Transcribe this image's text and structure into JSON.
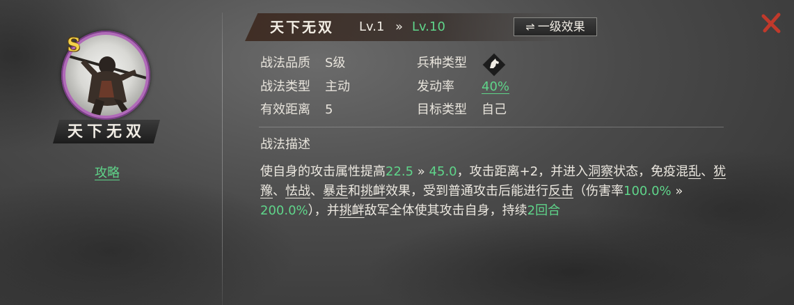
{
  "skill": {
    "name": "天下无双",
    "grade_letter": "S",
    "level_current": "Lv.1",
    "level_arrow": "»",
    "level_max": "Lv.10",
    "effect_button": "一级效果",
    "effect_button_icon": "swap-icon"
  },
  "left_panel": {
    "portrait_name": "天下无双",
    "strategy_link": "攻略"
  },
  "attributes": {
    "quality_label": "战法品质",
    "quality_value": "S级",
    "type_label": "战法类型",
    "type_value": "主动",
    "range_label": "有效距离",
    "range_value": "5",
    "troop_label": "兵种类型",
    "troop_icon": "cavalry-horse-icon",
    "rate_label": "发动率",
    "rate_value": "40%",
    "target_label": "目标类型",
    "target_value": "自己"
  },
  "description": {
    "title": "战法描述",
    "p1": "使自身的攻击属性提高",
    "v1": "22.5",
    "arrow1": " » ",
    "v2": "45.0",
    "p2": "，攻击距离+2，并进入",
    "k1": "洞察",
    "p3": "状态，免疫混",
    "k2": "乱",
    "p4": "、",
    "k3": "犹豫",
    "p5": "、",
    "k4": "怯战",
    "p6": "、",
    "k5": "暴走",
    "p7": "和",
    "k6": "挑衅",
    "p8": "效果，受到普通攻击后能进行",
    "k7": "反击",
    "p9": "（伤害率",
    "v3": "100.0%",
    "arrow2": " » ",
    "v4": "200.0%",
    "p10": "），并",
    "k8": "挑衅",
    "p11": "敌军全体使其攻击自身，持续",
    "v5": "2回合"
  },
  "colors": {
    "accent_green": "#5fd58a",
    "grade_gold": "#f3d24a",
    "close_red": "#c0392b",
    "portrait_ring": "#b06ab8"
  }
}
